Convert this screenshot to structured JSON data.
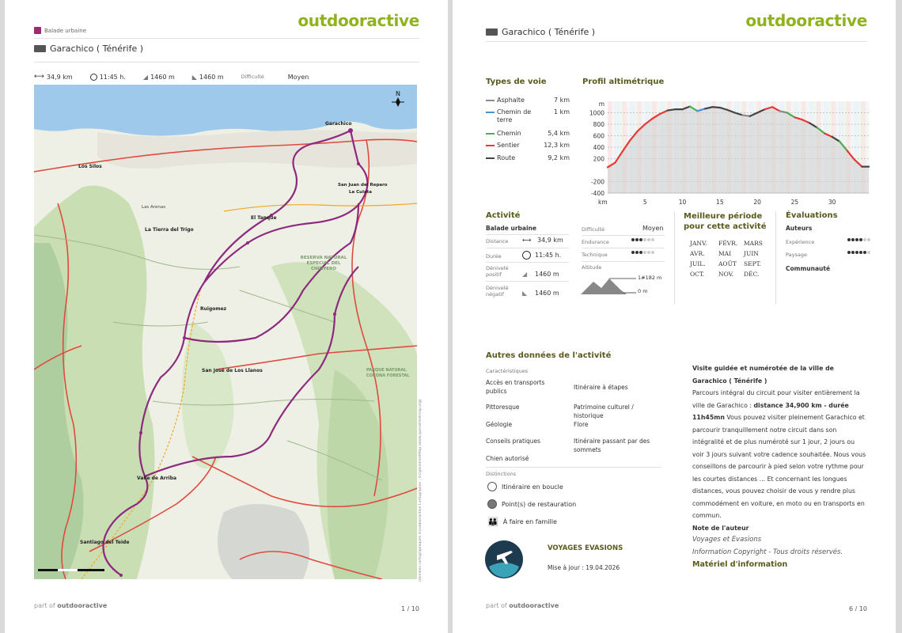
{
  "brand": "outdooractive",
  "page1": {
    "category": "Balade urbaine",
    "title": "Garachico ( Ténérife )",
    "stats": {
      "distance": "34,9 km",
      "duration": "11:45 h.",
      "ascent": "1460 m",
      "descent": "1460 m",
      "difficulty_label": "Difficulté",
      "difficulty_value": "Moyen"
    },
    "map_places": {
      "garachico": "Garachico",
      "los_silos": "Los Silos",
      "san_juan": "San Juan del Reparo",
      "la_culata": "La Culata",
      "el_tanque": "El Tanque",
      "las_arenas": "Las Arenas",
      "tierra_trigo": "La Tierra del Trigo",
      "ruigomez": "Ruigomez",
      "san_jose": "San José de Los Llanos",
      "valle_arriba": "Valle de Arriba",
      "santiago": "Santiago del Teide",
      "reserva": "RESERVA NATURAL ESPECIAL DEL CHINYERO",
      "parque": "PARQUE NATURAL CORONA FORESTAL"
    },
    "map_credit": "Données cartographiques ©outdooractive Cartographie ; ©OpenStreetMap (www.openstreetmap.org)",
    "footer_prefix": "part of",
    "footer_brand": "outdooractive",
    "page_number": "1 / 10"
  },
  "page2": {
    "title": "Garachico ( Ténérife )",
    "types_title": "Types de voie",
    "types": [
      {
        "name": "Asphalte",
        "km": "7 km",
        "color": "#8a8a8a"
      },
      {
        "name": "Chemin de terre",
        "km": "1 km",
        "color": "#4a90d9"
      },
      {
        "name": "Chemin",
        "km": "5,4 km",
        "color": "#4caf50"
      },
      {
        "name": "Sentier",
        "km": "12,3 km",
        "color": "#e53935"
      },
      {
        "name": "Route",
        "km": "9,2 km",
        "color": "#444444"
      }
    ],
    "profile_title": "Profil altimétrique",
    "chart_data": {
      "type": "area",
      "title": "Profil altimétrique",
      "xlabel": "km",
      "ylabel": "m",
      "x_ticks": [
        5,
        10,
        15,
        20,
        25,
        30
      ],
      "y_ticks": [
        1000,
        800,
        600,
        400,
        200,
        -200,
        -400
      ],
      "xlim": [
        0,
        34.9
      ],
      "ylim": [
        -400,
        1200
      ],
      "x": [
        0,
        1,
        2,
        3,
        4,
        5,
        6,
        7,
        8,
        9,
        10,
        11,
        12,
        13,
        14,
        15,
        16,
        17,
        18,
        19,
        20,
        21,
        22,
        23,
        24,
        25,
        26,
        27,
        28,
        29,
        30,
        31,
        32,
        33,
        34,
        34.9
      ],
      "y": [
        50,
        130,
        330,
        520,
        680,
        800,
        900,
        980,
        1040,
        1060,
        1060,
        1110,
        1030,
        1070,
        1100,
        1090,
        1050,
        1000,
        960,
        940,
        1000,
        1060,
        1100,
        1030,
        1000,
        920,
        880,
        820,
        740,
        640,
        580,
        500,
        340,
        180,
        60,
        60
      ]
    },
    "activity_title": "Activité",
    "activity_type": "Balade urbaine",
    "activity_rows": [
      {
        "label": "Distance",
        "value": "34,9 km"
      },
      {
        "label": "Durée",
        "value": "11:45 h."
      },
      {
        "label": "Dénivelé positif",
        "value": "1460 m"
      },
      {
        "label": "Dénivelé négatif",
        "value": "1460 m"
      }
    ],
    "ratings": {
      "difficulty_label": "Difficulté",
      "difficulty_value": "Moyen",
      "endurance_label": "Endurance",
      "endurance_level": 3,
      "technique_label": "Technique",
      "technique_level": 3,
      "altitude_label": "Altitude",
      "alt_max": "1#182 m",
      "alt_min": "0 m"
    },
    "best_period_title": "Meilleure période pour cette activité",
    "months": [
      "JANV.",
      "FÉVR.",
      "MARS",
      "AVR.",
      "MAI",
      "JUIN",
      "JUIL.",
      "AOÛT",
      "SEPT.",
      "OCT.",
      "NOV.",
      "DÉC."
    ],
    "evaluations_title": "Évaluations",
    "authors_label": "Auteurs",
    "experience_label": "Expérience",
    "experience_level": 4,
    "landscape_label": "Paysage",
    "landscape_level": 5,
    "community_label": "Communauté",
    "other_title": "Autres données de l'activité",
    "characteristics_label": "Caractéristiques",
    "characteristics": [
      [
        "Accès en transports publics",
        "Itinéraire à étapes"
      ],
      [
        "Pittoresque",
        "Patrimoine culturel / historique"
      ],
      [
        "Géologie",
        "Flore"
      ],
      [
        "Conseils pratiques",
        "Itinéraire passant par des sommets"
      ],
      [
        "Chien autorisé",
        ""
      ]
    ],
    "distinctions_label": "Distinctions",
    "distinctions": [
      "Itinéraire en boucle",
      "Point(s) de restauration",
      "À faire en famille"
    ],
    "author_name": "VOYAGES EVASIONS",
    "update": "Mise à jour : 19.04.2026",
    "desc_title": "Visite guidée et numérotée de la ville de Garachico ( Ténérife )",
    "desc_p1": "Parcours intégral du circuit pour visiter entièrement la ville de Garachico : ",
    "desc_bold": "distance 34,900 km - durée 11h45mn",
    "desc_p2": " Vous pouvez visiter pleinement Garachico et parcourir tranquillement notre circuit dans son intégralité et de plus numéroté sur 1 jour, 2 jours ou voir 3 jours suivant votre cadence souhaitée. Nous vous conseillons de parcourir à pied selon votre rythme pour les courtes distances ... Et concernant les longues distances, vous pouvez choisir de vous y rendre plus commodément en voiture, en moto ou en transports en commun.",
    "note_title": "Note de l'auteur",
    "note_author": "Voyages et Evasions",
    "copyright": "Information Copyright - Tous droits réservés.",
    "material_title": "Matériel d'information",
    "footer_prefix": "part of",
    "footer_brand": "outdooractive",
    "page_number": "6 / 10"
  }
}
